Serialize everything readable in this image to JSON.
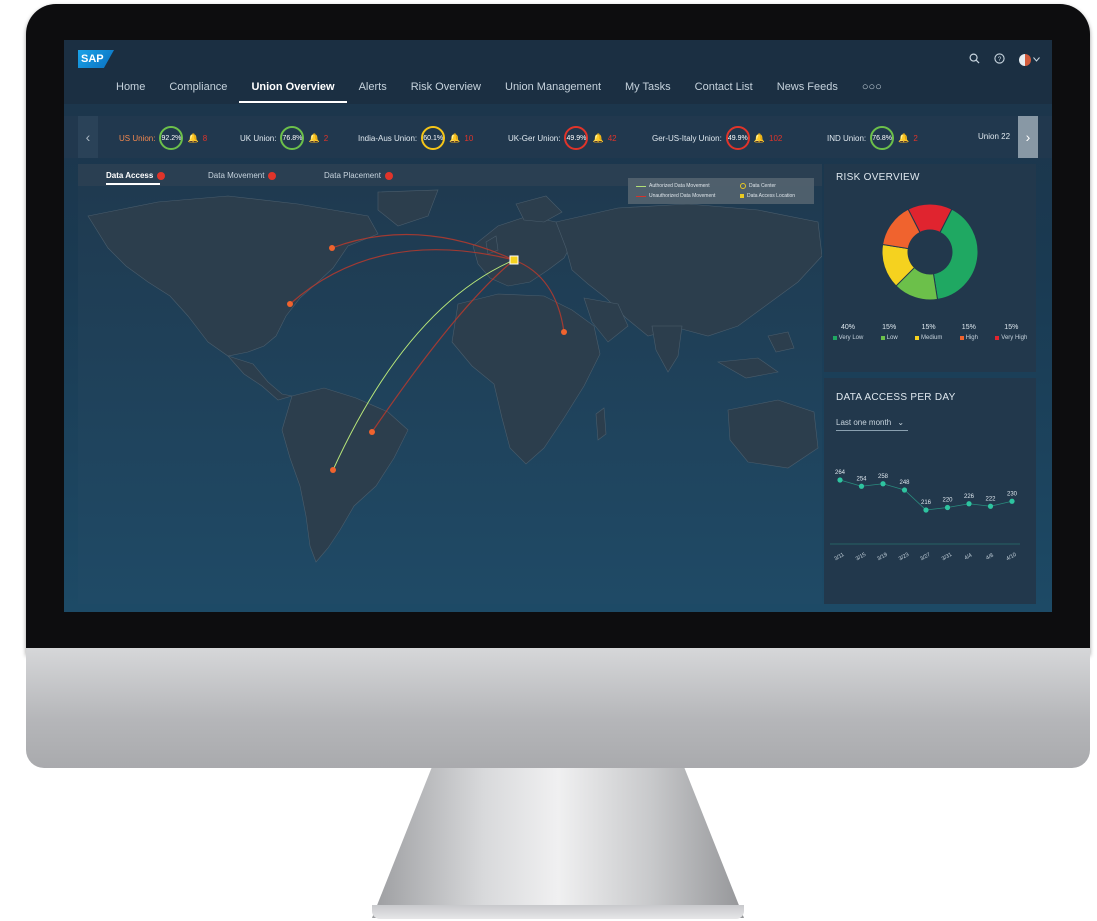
{
  "shell": {
    "logo": "SAP",
    "nav_tabs": [
      "Home",
      "Compliance",
      "Union Overview",
      "Alerts",
      "Risk Overview",
      "Union Management",
      "My Tasks",
      "Contact List",
      "News Feeds"
    ],
    "active_tab": "Union Overview",
    "overflow": "○○○",
    "icons": [
      "search-icon",
      "help-icon",
      "avatar",
      "chevron-down-icon"
    ]
  },
  "unions": [
    {
      "name": "US Union:",
      "percent": "92.2%",
      "alerts": "8",
      "ring_color": "#6cc04a",
      "highlight": true
    },
    {
      "name": "UK Union:",
      "percent": "76.8%",
      "alerts": "2",
      "ring_color": "#6cc04a",
      "highlight": false
    },
    {
      "name": "India-Aus Union:",
      "percent": "60.1%",
      "alerts": "10",
      "ring_color": "#f5c518",
      "highlight": false
    },
    {
      "name": "UK-Ger Union:",
      "percent": "49.9%",
      "alerts": "42",
      "ring_color": "#e0342a",
      "highlight": false
    },
    {
      "name": "Ger-US-Italy Union:",
      "percent": "49.9%",
      "alerts": "102",
      "ring_color": "#e0342a",
      "highlight": false
    },
    {
      "name": "IND Union:",
      "percent": "76.8%",
      "alerts": "2",
      "ring_color": "#6cc04a",
      "highlight": false
    },
    {
      "name": "Union 22",
      "percent": "",
      "alerts": "",
      "ring_color": "",
      "highlight": false
    }
  ],
  "subtabs": [
    {
      "label": "Data Access",
      "badge": "8",
      "active": true
    },
    {
      "label": "Data Movement",
      "badge": "2",
      "active": false
    },
    {
      "label": "Data Placement",
      "badge": "2",
      "active": false
    }
  ],
  "map_legend": {
    "authorized": "Authorized Data Movement",
    "unauthorized": "Unauthorized Data Movement",
    "data_center": "Data Center",
    "access_location": "Data Access Location"
  },
  "risk_overview": {
    "title": "RISK OVERVIEW",
    "chart_data": {
      "type": "pie",
      "categories": [
        "Very Low",
        "Low",
        "Medium",
        "High",
        "Very High"
      ],
      "values": [
        40,
        15,
        15,
        15,
        15
      ],
      "labels": [
        "40%",
        "15%",
        "15%",
        "15%",
        "15%"
      ],
      "colors": [
        "#1fa862",
        "#6cc04a",
        "#f5d21f",
        "#f0632e",
        "#e0242f"
      ]
    }
  },
  "data_access": {
    "title": "DATA ACCESS PER DAY",
    "range": "Last one month",
    "chart_data": {
      "type": "line",
      "categories": [
        "3/11",
        "3/15",
        "3/19",
        "3/23",
        "3/27",
        "3/31",
        "4/4",
        "4/8",
        "4/10"
      ],
      "values": [
        264,
        254,
        258,
        248,
        216,
        220,
        226,
        222,
        230
      ],
      "color": "#2ec4a0"
    }
  },
  "colors": {
    "authorized_line": "#b9e87a",
    "unauthorized_line": "#e0342a",
    "data_center": "#f5d21f",
    "access_location": "#f0632e"
  }
}
